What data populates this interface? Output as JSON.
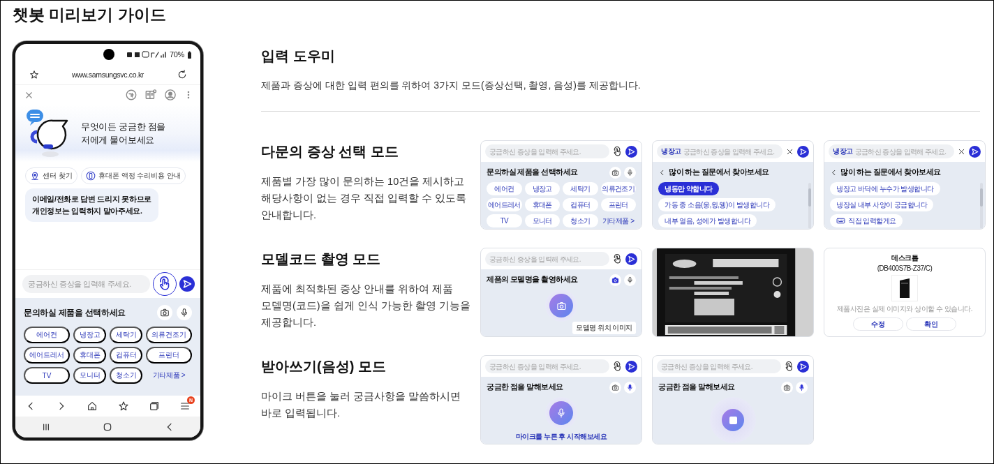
{
  "page_title": "챗봇 미리보기 가이드",
  "phone": {
    "battery": "70%",
    "url": "www.samsungsvc.co.kr",
    "greeting_lines": [
      "무엇이든 궁금한 점을",
      "저에게 물어보세요"
    ],
    "quick_links": [
      "센터 찾기",
      "휴대폰 액정 수리비용 안내"
    ],
    "notice_lines": [
      "이메일/전화로 답변 드리지 못하므로",
      "개인정보는 입력하지 말아주세요."
    ],
    "placeholder": "궁금하신 증상을 입력해 주세요.",
    "prompt": "문의하실 제품을 선택하세요",
    "products": [
      "에어컨",
      "냉장고",
      "세탁기",
      "의류건조기",
      "에어드레서",
      "휴대폰",
      "컴퓨터",
      "프린터",
      "TV",
      "모니터",
      "청소기"
    ],
    "more": "기타제품 >",
    "menu_badge": "N"
  },
  "intro": {
    "title": "입력 도우미",
    "description": "제품과 증상에 대한 입력 편의를 위하여 3가지 모드(증상선택, 촬영, 음성)를 제공합니다."
  },
  "modes": [
    {
      "title": "다문의 증상 선택 모드",
      "description_lines": [
        "제품별 가장 많이 문의하는 10건을 제시하고",
        "해당사항이 없는 경우 직접 입력할 수 있도록",
        "안내합니다."
      ],
      "screens": [
        {
          "kind": "product_select",
          "placeholder": "궁금하신 증상을 입력해 주세요.",
          "prompt": "문의하실 제품을 선택하세요",
          "products": [
            "에어컨",
            "냉장고",
            "세탁기",
            "의류건조기",
            "에어드레서",
            "휴대폰",
            "컴퓨터",
            "프린터",
            "TV",
            "모니터",
            "청소기"
          ],
          "more": "기타제품 >"
        },
        {
          "kind": "faq",
          "tag": "냉장고",
          "placeholder": "궁금하신 증상을 입력해 주세요.",
          "header": "많이 하는 질문에서 찾아보세요",
          "items": [
            {
              "text": "냉동만 약합니다",
              "selected": true
            },
            {
              "text": "가동 중 소음(웅,윙,웽)이 발생합니다",
              "selected": false
            },
            {
              "text": "내부 얼음, 성에가 발생합니다",
              "selected": false
            }
          ]
        },
        {
          "kind": "faq",
          "tag": "냉장고",
          "placeholder": "궁금하신 증상을 입력해 주세요.",
          "header": "많이 하는 질문에서 찾아보세요",
          "items": [
            {
              "text": "냉장고 바닥에 누수가 발생합니다",
              "selected": false
            },
            {
              "text": "냉장실 내부 사양이 궁금합니다",
              "selected": false
            }
          ],
          "direct": "직접 입력할게요"
        }
      ]
    },
    {
      "title": "모델코드 촬영 모드",
      "description_lines": [
        "제품에 최적화된 증상 안내를 위하여 제품",
        "모델명(코드)을 쉽게 인식 가능한 촬영 기능을",
        "제공합니다."
      ],
      "screens": [
        {
          "kind": "camera",
          "placeholder": "궁금하신 증상을 입력해 주세요.",
          "prompt": "제품의 모델명을 촬영하세요",
          "guide": "모델명 위치 이미지"
        },
        {
          "kind": "picture"
        },
        {
          "kind": "product_result",
          "name": "데스크톱",
          "model": "(DB400S7B-Z37/C)",
          "note": "제품사진은 실제 이미지와 상이할 수 있습니다.",
          "buttons": [
            "수정",
            "확인"
          ]
        }
      ]
    },
    {
      "title": "받아쓰기(음성) 모드",
      "description_lines": [
        "마이크 버튼을 눌러 궁금사항을 말씀하시면",
        "바로 입력됩니다."
      ],
      "screens": [
        {
          "kind": "voice",
          "recording": false,
          "placeholder": "궁금하신 증상을 입력해 주세요.",
          "prompt": "궁금한 점을 말해보세요",
          "hint": "마이크를 누른 후 시작해보세요"
        },
        {
          "kind": "voice",
          "recording": true,
          "placeholder": "궁금하신 증상을 입력해 주세요.",
          "prompt": "궁금한 점을 말해보세요"
        }
      ]
    }
  ]
}
